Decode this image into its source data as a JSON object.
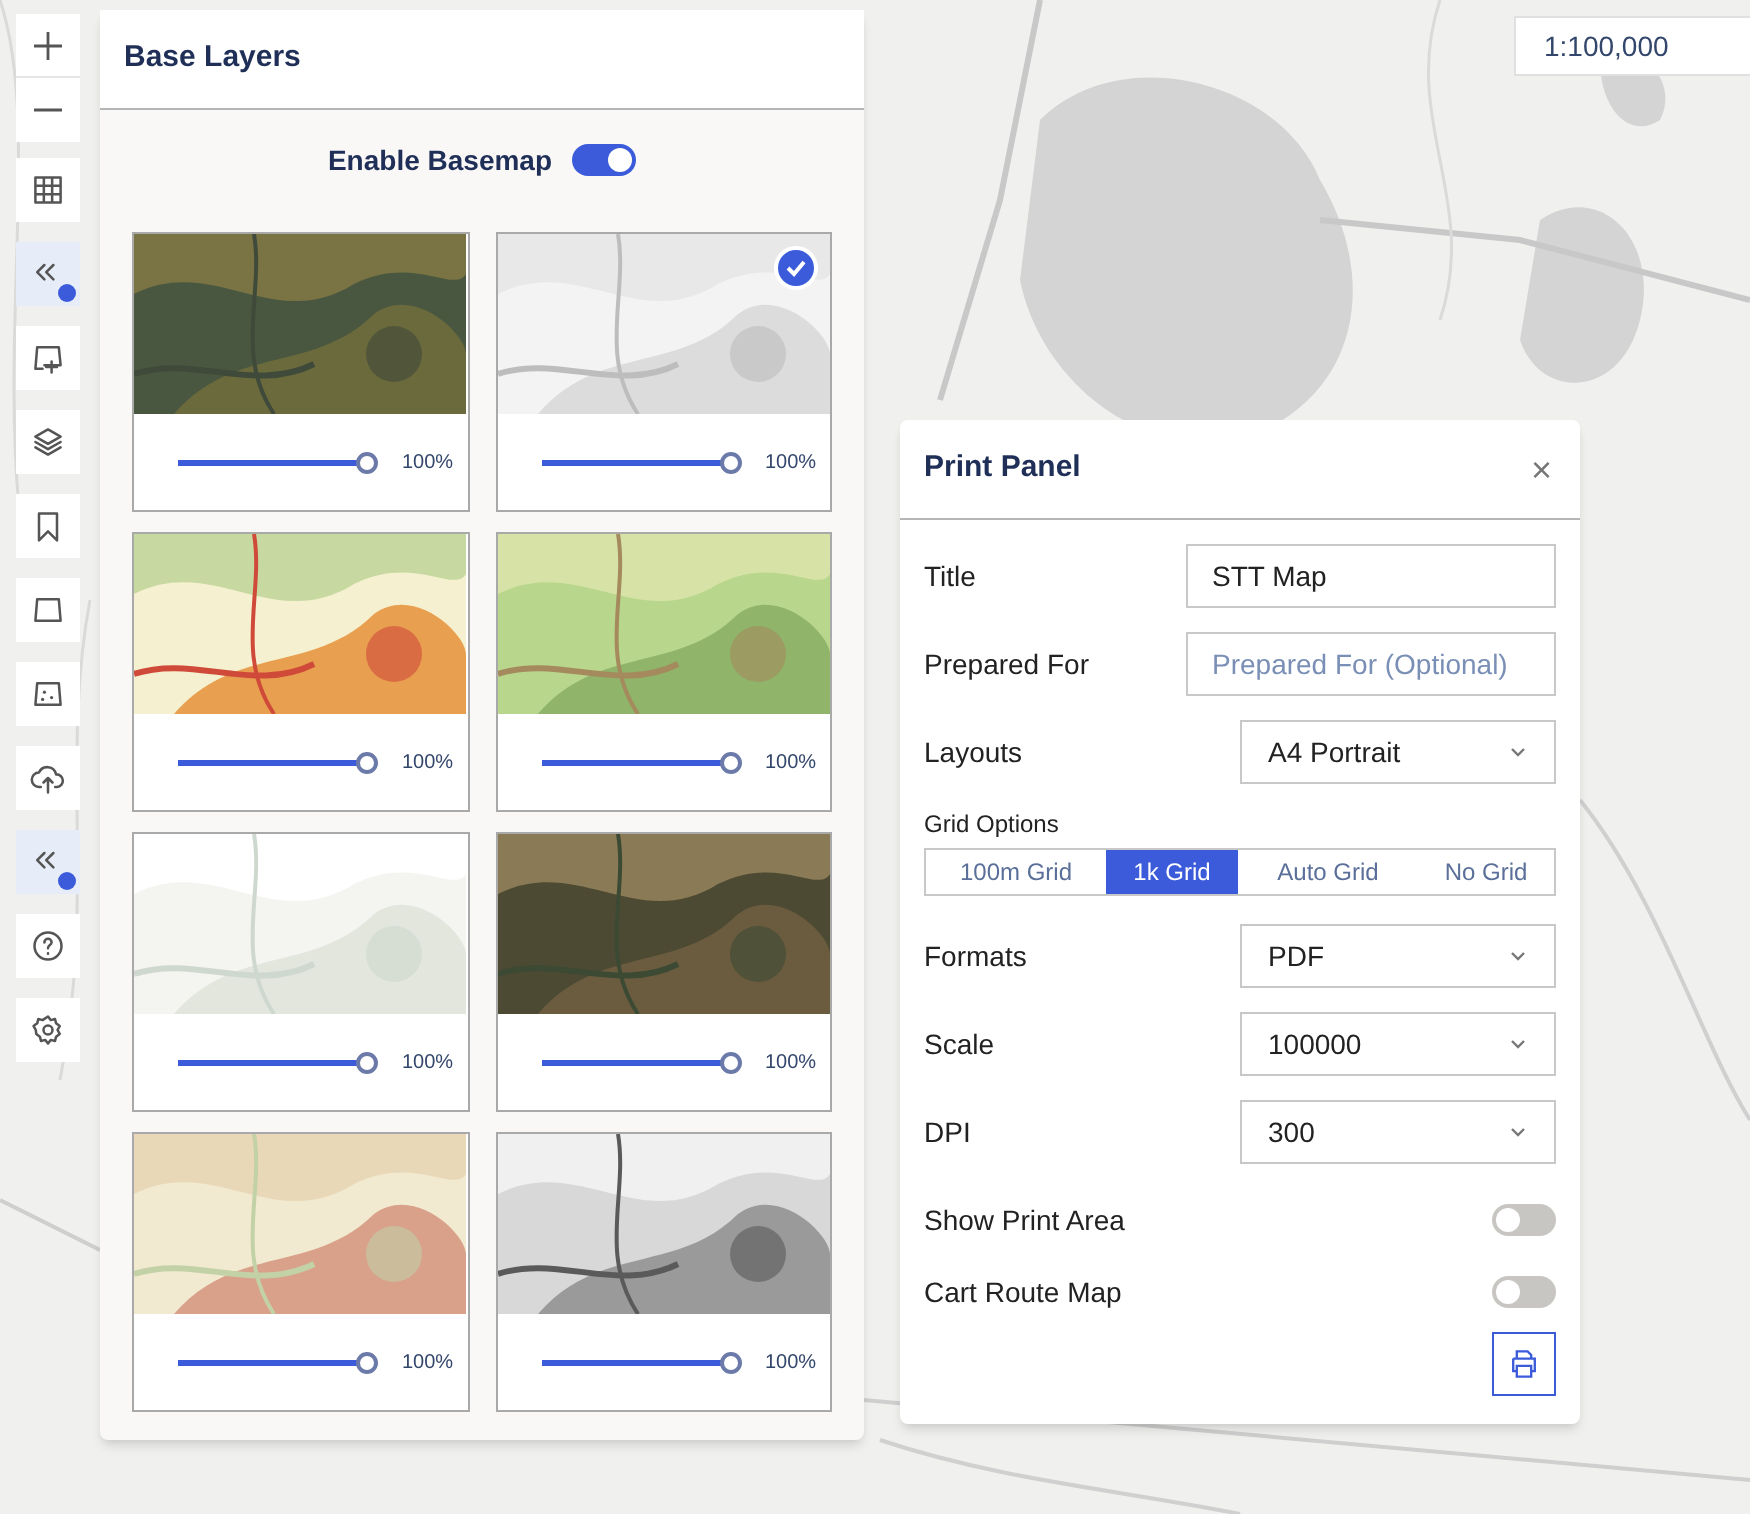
{
  "toolbar": [
    {
      "selected": false
    },
    {
      "selected": false
    },
    {
      "selected": false
    },
    {
      "selected": true
    },
    {
      "selected": false
    },
    {
      "selected": false
    },
    {
      "selected": false
    },
    {
      "selected": false
    },
    {
      "selected": false
    },
    {
      "selected": false
    },
    {
      "selected": true
    },
    {
      "selected": false
    },
    {
      "selected": false
    }
  ],
  "scale_box": {
    "value": "1:100,000"
  },
  "base_layers": {
    "title": "Base Layers",
    "enable_label": "Enable Basemap",
    "enabled": true,
    "layers": [
      {
        "selected": false,
        "level": 1,
        "reading": "100%"
      },
      {
        "selected": true,
        "level": 1,
        "reading": "100%"
      },
      {
        "selected": false,
        "level": 1,
        "reading": "100%"
      },
      {
        "selected": false,
        "level": 1,
        "reading": "100%"
      },
      {
        "selected": false,
        "level": 1,
        "reading": "100%"
      },
      {
        "selected": false,
        "level": 1,
        "reading": "100%"
      },
      {
        "selected": false,
        "level": 1,
        "reading": "100%"
      },
      {
        "selected": false,
        "level": 1,
        "reading": "100%"
      }
    ]
  },
  "print_panel": {
    "title": "Print Panel",
    "close": "×",
    "fields": [
      {
        "kind": "text",
        "label": "Title",
        "value": "STT Map"
      },
      {
        "kind": "text",
        "label": "Prepared For",
        "placeholder": "Prepared For (Optional)"
      },
      {
        "kind": "select",
        "label": "Layouts",
        "value": "A4 Portrait"
      }
    ],
    "grid_options": {
      "label": "Grid Options",
      "options": [
        {
          "label": "100m Grid",
          "selected": false
        },
        {
          "label": "1k Grid",
          "selected": true
        },
        {
          "label": "Auto Grid",
          "selected": false
        },
        {
          "label": "No Grid",
          "selected": false
        }
      ]
    },
    "selects": [
      {
        "kind": "select",
        "label": "Formats",
        "value": "PDF"
      },
      {
        "kind": "select",
        "label": "Scale",
        "value": "100000"
      },
      {
        "kind": "select",
        "label": "DPI",
        "value": "300"
      }
    ],
    "toggles": [
      {
        "label": "Show Print Area",
        "on": false
      },
      {
        "label": "Cart Route Map",
        "on": false
      }
    ]
  }
}
